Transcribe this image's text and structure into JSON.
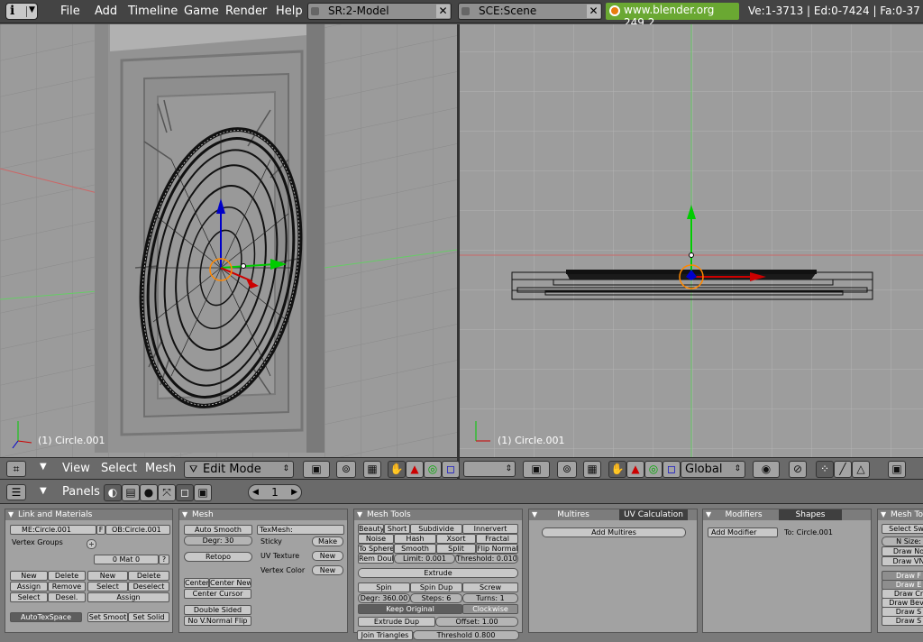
{
  "topbar": {
    "menus": [
      "File",
      "Add",
      "Timeline",
      "Game",
      "Render",
      "Help"
    ],
    "screen_field": "SR:2-Model",
    "scene_field": "SCE:Scene",
    "website": "www.blender.org 249.2",
    "stats": "Ve:1-3713 | Ed:0-7424 | Fa:0-37"
  },
  "viewport_left": {
    "object_label": "(1) Circle.001",
    "header": {
      "view": "View",
      "select": "Select",
      "mesh": "Mesh",
      "mode": "Edit Mode"
    }
  },
  "viewport_right": {
    "object_label": "(1) Circle.001",
    "header": {
      "orientation": "Global"
    }
  },
  "buttons_window": {
    "panels_label": "Panels",
    "frame": "1"
  },
  "panel_link": {
    "title": "Link and Materials",
    "me_field": "ME:Circle.001",
    "f_btn": "F",
    "ob_field": "OB:Circle.001",
    "vertex_groups": "Vertex Groups",
    "mat_field": "0 Mat 0",
    "q": "?",
    "new1": "New",
    "delete1": "Delete",
    "assign1": "Assign",
    "remove": "Remove",
    "select1": "Select",
    "desel": "Desel.",
    "new2": "New",
    "delete2": "Delete",
    "select2": "Select",
    "deselect": "Deselect",
    "assign2": "Assign",
    "autotex": "AutoTexSpace",
    "set_smooth": "Set Smoot",
    "set_solid": "Set Solid"
  },
  "panel_mesh": {
    "title": "Mesh",
    "auto_smooth": "Auto Smooth",
    "degr": "Degr: 30",
    "retopo": "Retopo",
    "texmesh": "TexMesh:",
    "sticky": "Sticky",
    "make": "Make",
    "uv_texture": "UV Texture",
    "new_uv": "New",
    "vertex_color": "Vertex Color",
    "new_vc": "New",
    "center": "Center",
    "center_new": "Center New",
    "center_cursor": "Center Cursor",
    "double_sided": "Double Sided",
    "no_vnormal_flip": "No V.Normal Flip"
  },
  "panel_meshtools": {
    "title": "Mesh Tools",
    "beauty": "Beauty",
    "short": "Short",
    "subdivide": "Subdivide",
    "innervert": "Innervert",
    "noise": "Noise",
    "hash": "Hash",
    "xsort": "Xsort",
    "fractal": "Fractal",
    "to_sphere": "To Sphere",
    "smooth": "Smooth",
    "split": "Split",
    "flip_normal": "Flip Normal",
    "rem_doubl": "Rem Doubl",
    "limit": "Limit: 0.001",
    "threshold": "Threshold: 0.010",
    "extrude": "Extrude",
    "spin": "Spin",
    "spin_dup": "Spin Dup",
    "screw": "Screw",
    "degr": "Degr: 360.00",
    "steps": "Steps: 6",
    "turns": "Turns: 1",
    "keep_original": "Keep Original",
    "clockwise": "Clockwise",
    "extrude_dup": "Extrude Dup",
    "offset": "Offset: 1.00",
    "join_triangles": "Join Triangles",
    "threshold2": "Threshold 0.800"
  },
  "panel_multires": {
    "tab1": "Multires",
    "tab2": "UV Calculation",
    "add_multires": "Add Multires"
  },
  "panel_modifiers": {
    "tab1": "Modifiers",
    "tab2": "Shapes",
    "add_modifier": "Add Modifier",
    "to": "To: Circle.001"
  },
  "panel_meshtools_more": {
    "title": "Mesh Too",
    "select_swap": "Select Swa",
    "nsize": "N Size:",
    "draw_no": "Draw No",
    "draw_vn": "Draw VN",
    "items": [
      "Draw F",
      "Draw E",
      "Draw Cr",
      "Draw Beve",
      "Draw S",
      "Draw S"
    ]
  }
}
